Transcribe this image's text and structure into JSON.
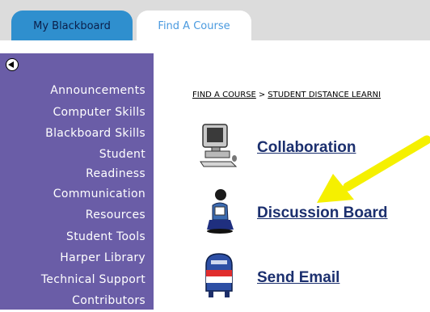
{
  "tabs": [
    {
      "label": "My Blackboard",
      "active": true
    },
    {
      "label": "Find A Course",
      "active": false
    }
  ],
  "sidebar": {
    "collapse_icon": "collapse-left-icon",
    "items": [
      {
        "label": "Announcements"
      },
      {
        "label": "Computer Skills"
      },
      {
        "label": "Blackboard Skills"
      },
      {
        "label": "Student"
      },
      {
        "label": "Readiness"
      },
      {
        "label": "Communication"
      },
      {
        "label": "Resources"
      },
      {
        "label": "Student Tools"
      },
      {
        "label": "Harper Library"
      },
      {
        "label": "Technical Support"
      },
      {
        "label": "Contributors"
      }
    ]
  },
  "breadcrumb": {
    "part1": "FIND A COURSE",
    "separator": ">",
    "part2": "STUDENT DISTANCE LEARNI"
  },
  "tools": [
    {
      "label": "Collaboration",
      "icon": "computer-icon"
    },
    {
      "label": "Discussion Board",
      "icon": "person-icon"
    },
    {
      "label": "Send Email",
      "icon": "mailbox-icon"
    }
  ],
  "colors": {
    "tab_active": "#2f8fce",
    "sidebar": "#6a5da7",
    "link": "#1b2f6e",
    "arrow": "#f5f000"
  }
}
